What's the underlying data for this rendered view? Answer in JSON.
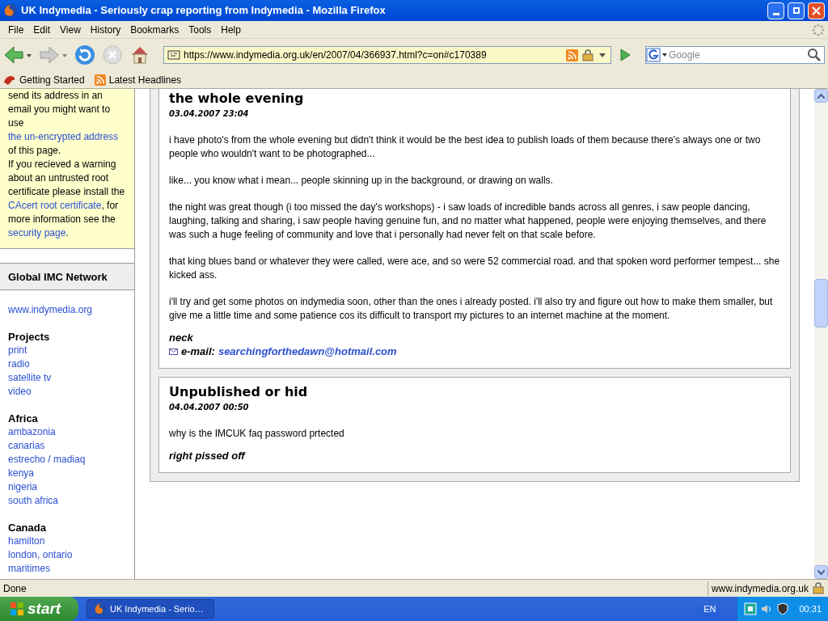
{
  "window": {
    "title": "UK Indymedia - Seriously crap reporting from Indymedia - Mozilla Firefox"
  },
  "menu": [
    "File",
    "Edit",
    "View",
    "History",
    "Bookmarks",
    "Tools",
    "Help"
  ],
  "address_bar": {
    "value": "https://www.indymedia.org.uk/en/2007/04/366937.html?c=on#c170389"
  },
  "search": {
    "placeholder": "Google"
  },
  "bookmarks": [
    "Getting Started",
    "Latest Headlines"
  ],
  "sidebar": {
    "notice": [
      [
        {
          "text": "send its address in an email you might want to use ",
          "link": false
        },
        {
          "text": "the un-encrypted address",
          "link": true
        },
        {
          "text": " of this page.",
          "link": false
        }
      ],
      [
        {
          "text": "If you recieved a warning about an untrusted root certificate please install the ",
          "link": false
        },
        {
          "text": "CAcert root certificate",
          "link": true
        },
        {
          "text": ", for more information see the ",
          "link": false
        },
        {
          "text": "security page",
          "link": true
        },
        {
          "text": ".",
          "link": false
        }
      ]
    ],
    "network": {
      "title": "Global IMC Network",
      "links": [
        "www.indymedia.org"
      ],
      "groups": [
        {
          "heading": "Projects",
          "links": [
            "print",
            "radio",
            "satellite tv",
            "video"
          ]
        },
        {
          "heading": "Africa",
          "links": [
            "ambazonia",
            "canarias",
            "estrecho / madiaq",
            "kenya",
            "nigeria",
            "south africa"
          ]
        },
        {
          "heading": "Canada",
          "links": [
            "hamilton",
            "london, ontario",
            "maritimes"
          ]
        }
      ]
    }
  },
  "comments": [
    {
      "title": "the whole evening",
      "date": "03.04.2007 23:04",
      "paragraphs": [
        "i have photo's from the whole evening but didn't think it would be the best idea to publish loads of them because there's always one or two people who wouldn't want to be photographed...",
        "like... you know what i mean... people skinning up in the background, or drawing on walls.",
        "the night was great though (i too missed the day's workshops) - i saw loads of incredible bands across all genres, i saw people dancing, laughing, talking and sharing, i saw people having genuine fun, and no matter what happened, people were enjoying themselves, and there was such a huge feeling of community and love that i personally had never felt on that scale before.",
        "that king blues band or whatever they were called, were ace, and so were 52 commercial road. and that spoken word performer tempest... she kicked ass.",
        "i'll try and get some photos on indymedia soon, other than the ones i already posted. i'll also try and figure out how to make them smaller, but give me a little time and some patience cos its difficult to transport my pictures to an internet machine at the moment."
      ],
      "author": "neck",
      "email_label": "e-mail:",
      "email": "searchingforthedawn@hotmail.com"
    },
    {
      "title": "Unpublished or hid",
      "date": "04.04.2007 00:50",
      "paragraphs": [
        "why is the IMCUK faq password prtected"
      ],
      "author": "right pissed off"
    }
  ],
  "status_bar": {
    "text": "Done",
    "domain": "www.indymedia.org.uk"
  },
  "taskbar": {
    "start": "start",
    "task": "UK Indymedia - Serio…",
    "language": "EN",
    "clock": "00:31"
  }
}
